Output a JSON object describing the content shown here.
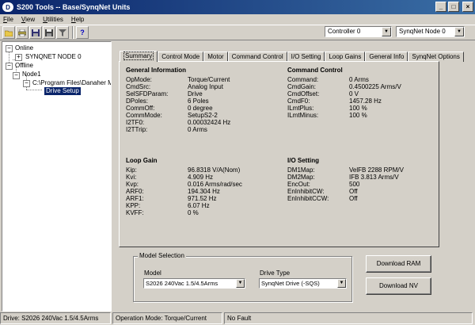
{
  "window": {
    "title": "S200 Tools -- Base/SynqNet Units",
    "app_icon_glyph": "D"
  },
  "menu": [
    {
      "label": "File",
      "mnemonic": "F",
      "rest": "ile"
    },
    {
      "label": "View",
      "mnemonic": "V",
      "rest": "iew"
    },
    {
      "label": "Utilities",
      "mnemonic": "U",
      "rest": "tilities"
    },
    {
      "label": "Help",
      "mnemonic": "H",
      "rest": "elp"
    }
  ],
  "toolbar": {
    "icons": [
      "open-folder-icon",
      "print-icon",
      "floppy-disk-icon",
      "floppy-save-icon",
      "filter-icon",
      "help-icon"
    ],
    "help_glyph": "?",
    "controller_combo": "Controller 0",
    "node_combo": "SynqNet Node 0"
  },
  "tree": {
    "online": "Online",
    "synqnet_node": "SYNQNET NODE 0",
    "offline": "Offline",
    "node1": "Node1",
    "path": "C:\\Program Files\\Danaher M",
    "drive_setup": "Drive Setup",
    "expander_plus": "+",
    "expander_minus": "−"
  },
  "tabs": [
    "Summary",
    "Control Mode",
    "Motor",
    "Command Control",
    "I/O Setting",
    "Loop Gains",
    "General Info",
    "SynqNet Options"
  ],
  "summary": {
    "general": {
      "heading": "General Information",
      "rows": [
        {
          "k": "OpMode:",
          "v": "Torque/Current"
        },
        {
          "k": "CmdSrc:",
          "v": "Analog Input"
        },
        {
          "k": "SelSFDParam:",
          "v": "Drive"
        },
        {
          "k": "DPoles:",
          "v": "6 Poles"
        },
        {
          "k": "CommOff:",
          "v": "0 degree"
        },
        {
          "k": "CommMode:",
          "v": "SetupS2-2"
        },
        {
          "k": "I2TF0:",
          "v": "0.00032424 Hz"
        },
        {
          "k": "I2TTrip:",
          "v": "0 Arms"
        }
      ]
    },
    "command": {
      "heading": "Command Control",
      "rows": [
        {
          "k": "Command:",
          "v": "0 Arms"
        },
        {
          "k": "CmdGain:",
          "v": "0.4500225 Arms/V"
        },
        {
          "k": "CmdOffset:",
          "v": "0 V"
        },
        {
          "k": "CmdF0:",
          "v": "1457.28 Hz"
        },
        {
          "k": "ILmtPlus:",
          "v": "100 %"
        },
        {
          "k": "ILmtMinus:",
          "v": "100 %"
        }
      ]
    },
    "loop": {
      "heading": "Loop Gain",
      "rows": [
        {
          "k": "Kip:",
          "v": "96.8318 V/A(Nom)"
        },
        {
          "k": "Kvi:",
          "v": "4.909 Hz"
        },
        {
          "k": "Kvp:",
          "v": "0.016 Arms/rad/sec"
        },
        {
          "k": "ARF0:",
          "v": "194.304 Hz"
        },
        {
          "k": "ARF1:",
          "v": "971.52 Hz"
        },
        {
          "k": "KPP:",
          "v": "6.07 Hz"
        },
        {
          "k": "KVFF:",
          "v": "0 %"
        }
      ]
    },
    "io": {
      "heading": "I/O Setting",
      "rows": [
        {
          "k": "DM1Map:",
          "v": "VelFB 2288 RPM/V"
        },
        {
          "k": "DM2Map:",
          "v": "IFB 3.813 Arms/V"
        },
        {
          "k": "EncOut:",
          "v": "500"
        },
        {
          "k": "EnInhibitCW:",
          "v": "Off"
        },
        {
          "k": "EnInhibitCCW:",
          "v": "Off"
        }
      ]
    }
  },
  "model_selection": {
    "legend": "Model Selection",
    "model_label": "Model",
    "model_value": "S2026 240Vac 1.5/4.5Arms",
    "drive_type_label": "Drive Type",
    "drive_type_value": "SynqNet Drive (-SQS)"
  },
  "buttons": {
    "download_ram": "Download RAM",
    "download_nv": "Download NV"
  },
  "status": {
    "drive": "Drive: S2026 240Vac 1.5/4.5Arms",
    "op_mode": "Operation Mode: Torque/Current",
    "fault": "No Fault"
  },
  "colors": {
    "titlebar_start": "#0a246a",
    "titlebar_end": "#3a6ea5",
    "selection": "#0a246a",
    "face": "#d4d0c8"
  }
}
